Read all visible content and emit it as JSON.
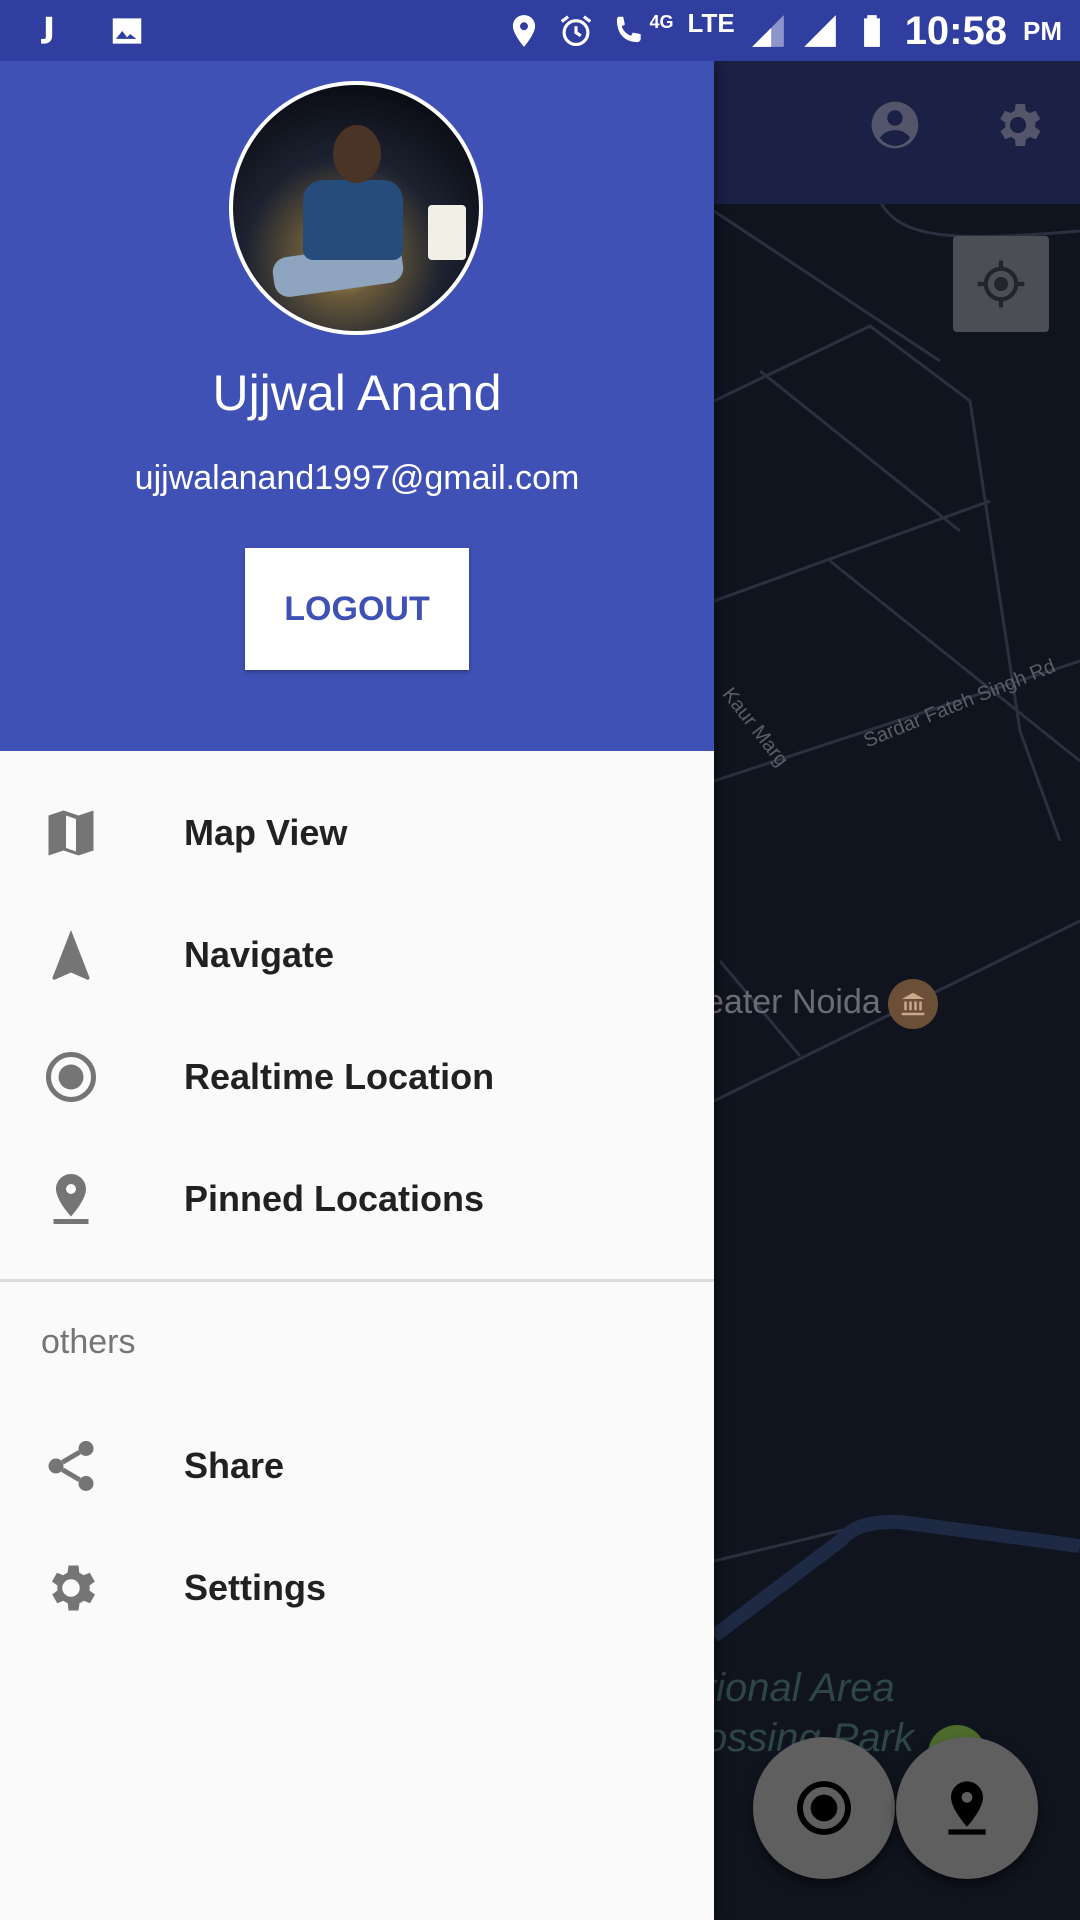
{
  "status_bar": {
    "time": "10:58",
    "ampm": "PM",
    "icons": [
      "jio-icon",
      "image-icon",
      "location-icon",
      "alarm-icon",
      "volte-call-icon",
      "lte-icon",
      "signal-icon",
      "signal-icon",
      "battery-icon"
    ],
    "network_4g": "4G",
    "network_lte": "LTE"
  },
  "drawer": {
    "header": {
      "name": "Ujjwal Anand",
      "email": "ujjwalanand1997@gmail.com",
      "logout_label": "LOGOUT"
    },
    "items": [
      {
        "label": "Map View",
        "icon": "map-icon"
      },
      {
        "label": "Navigate",
        "icon": "navigation-arrow-icon"
      },
      {
        "label": "Realtime Location",
        "icon": "radio-button-icon"
      },
      {
        "label": "Pinned Locations",
        "icon": "pin-drop-icon"
      }
    ],
    "section_title": "others",
    "others": [
      {
        "label": "Share",
        "icon": "share-icon"
      },
      {
        "label": "Settings",
        "icon": "settings-icon"
      }
    ]
  },
  "map": {
    "labels": {
      "road1": "Kaur Marg",
      "road2": "Sardar Fateh Singh Rd",
      "place": "eater Noida",
      "area1": "tional Area",
      "area2": "ossing Park"
    },
    "toolbar_icons": [
      "account-circle-icon",
      "settings-icon"
    ],
    "fabs": [
      "record-icon",
      "pin-drop-icon"
    ]
  },
  "colors": {
    "primary": "#3f51b5",
    "primary_dark": "#303f9f",
    "map_bg": "#10141f"
  }
}
